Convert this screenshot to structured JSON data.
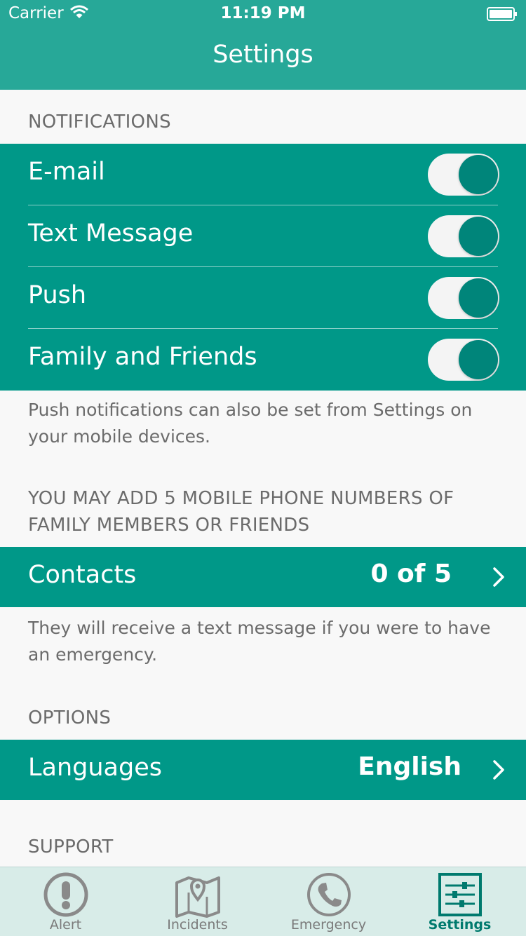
{
  "status": {
    "carrier": "Carrier",
    "time": "11:19 PM"
  },
  "nav": {
    "title": "Settings"
  },
  "notifications": {
    "header": "NOTIFICATIONS",
    "rows": [
      {
        "label": "E-mail",
        "on": true
      },
      {
        "label": "Text Message",
        "on": true
      },
      {
        "label": "Push",
        "on": true
      },
      {
        "label": "Family and Friends",
        "on": true
      }
    ],
    "footer": "Push notifications can also be set from Settings on your mobile devices."
  },
  "contacts_section": {
    "header": "YOU MAY ADD 5 MOBILE PHONE NUMBERS OF FAMILY MEMBERS OR FRIENDS",
    "label": "Contacts",
    "value": "0 of 5",
    "footer": "They will receive a text message if you were to have an emergency."
  },
  "options": {
    "header": "OPTIONS",
    "label": "Languages",
    "value": "English"
  },
  "support": {
    "header": "SUPPORT"
  },
  "tabs": [
    {
      "label": "Alert",
      "icon": "alert-icon",
      "active": false
    },
    {
      "label": "Incidents",
      "icon": "map-pin-icon",
      "active": false
    },
    {
      "label": "Emergency",
      "icon": "phone-icon",
      "active": false
    },
    {
      "label": "Settings",
      "icon": "sliders-icon",
      "active": true
    }
  ],
  "colors": {
    "accent": "#009888",
    "header": "#27a898",
    "tab_active": "#007a6e"
  }
}
